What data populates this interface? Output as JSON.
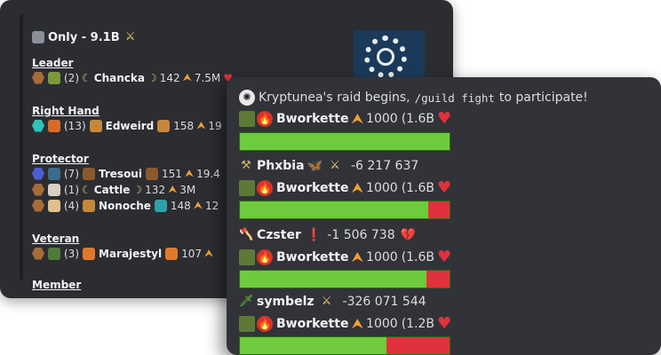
{
  "guild_panel": {
    "title": "Only - 9.1B",
    "sections": [
      {
        "name": "Leader",
        "members": [
          {
            "count": "(2)",
            "player": "Chancka",
            "level": "142",
            "power": "7.5M"
          }
        ]
      },
      {
        "name": "Right Hand",
        "members": [
          {
            "count": "(13)",
            "player": "Edweird",
            "level": "158",
            "power": "19"
          }
        ]
      },
      {
        "name": "Protector",
        "members": [
          {
            "count": "(7)",
            "player": "Tresoui",
            "level": "151",
            "power": "19.4"
          },
          {
            "count": "(1)",
            "player": "Cattle",
            "level": "132",
            "power": "3M"
          },
          {
            "count": "(4)",
            "player": "Nonoche",
            "level": "148",
            "power": "12"
          }
        ]
      },
      {
        "name": "Veteran",
        "members": [
          {
            "count": "(3)",
            "player": "Marajestyl",
            "level": "107",
            "power": ""
          }
        ]
      },
      {
        "name": "Member",
        "members": []
      }
    ]
  },
  "raid": {
    "header_prefix": "Kryptunea's raid begins,",
    "command": "/guild fight",
    "header_suffix": "to participate!",
    "boss_name": "Bworkette",
    "boss_level": "1000",
    "events": [
      {
        "boss_hp": "(1.6B",
        "bar_fill_pct": 100,
        "attacker": null
      },
      {
        "attacker": {
          "name": "Phxbia",
          "damage": "-6 217 637"
        },
        "boss_hp": "(1.6B",
        "bar_fill_pct": 90
      },
      {
        "attacker": {
          "name": "Czster",
          "damage": "-1 506 738"
        },
        "boss_hp": "(1.6B",
        "bar_fill_pct": 89
      },
      {
        "attacker": {
          "name": "symbelz",
          "damage": "-326 071 544"
        },
        "boss_hp": "(1.2B",
        "bar_fill_pct": 70
      }
    ]
  },
  "colors": {
    "hp_green": "#6ecb3c",
    "hp_red": "#e0313c",
    "card_back": "#2b2d31",
    "card_front": "#313338"
  }
}
